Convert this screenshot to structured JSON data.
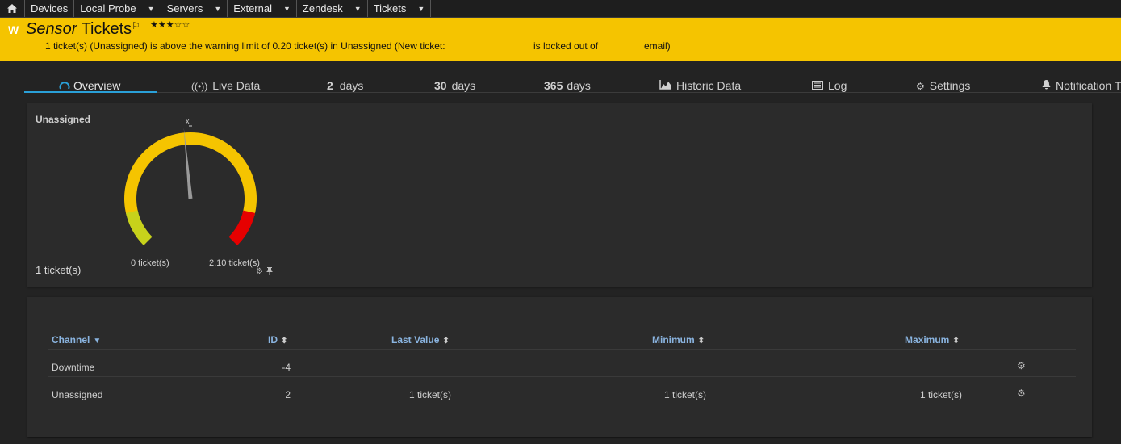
{
  "breadcrumbs": {
    "home_icon": "home-icon",
    "items": [
      {
        "label": "Devices",
        "has_menu": false
      },
      {
        "label": "Local Probe",
        "has_menu": true
      },
      {
        "label": "Servers",
        "has_menu": true
      },
      {
        "label": "External",
        "has_menu": true
      },
      {
        "label": "Zendesk",
        "has_menu": true
      },
      {
        "label": "Tickets",
        "has_menu": true
      }
    ]
  },
  "header": {
    "status_badge": "W",
    "title_prefix": "Sensor",
    "title": "Tickets",
    "priority_stars": "★★★☆☆",
    "warning_part1": "1 ticket(s) (Unassigned) is above the warning limit of 0.20 ticket(s) in Unassigned (New ticket:",
    "warning_part2": "is locked out of",
    "warning_part3": "email)",
    "background_color": "#f5c400"
  },
  "tabs": [
    {
      "label": "Overview",
      "icon": "gauge-icon",
      "active": true
    },
    {
      "label": "Live Data",
      "icon": "live-data-icon"
    },
    {
      "num": "2",
      "label": "days"
    },
    {
      "num": "30",
      "label": "days"
    },
    {
      "num": "365",
      "label": "days"
    },
    {
      "label": "Historic Data",
      "icon": "chart-icon"
    },
    {
      "label": "Log",
      "icon": "log-icon"
    },
    {
      "label": "Settings",
      "icon": "gear-icon"
    },
    {
      "label": "Notification T",
      "icon": "bell-icon"
    }
  ],
  "gauge": {
    "channel": "Unassigned",
    "min_label": "0 ticket(s)",
    "max_label": "2.10 ticket(s)",
    "value_label": "1 ticket(s)",
    "needle_fraction": 0.48,
    "colors": {
      "ok": "#c7d21b",
      "warning": "#f5c400",
      "error": "#e60000",
      "needle": "#9a9a9a"
    }
  },
  "table": {
    "headers": {
      "channel": "Channel",
      "id": "ID",
      "last_value": "Last Value",
      "minimum": "Minimum",
      "maximum": "Maximum"
    },
    "rows": [
      {
        "channel": "Downtime",
        "id": "-4",
        "last_value": "",
        "minimum": "",
        "maximum": ""
      },
      {
        "channel": "Unassigned",
        "id": "2",
        "last_value": "1 ticket(s)",
        "minimum": "1 ticket(s)",
        "maximum": "1 ticket(s)"
      }
    ]
  }
}
